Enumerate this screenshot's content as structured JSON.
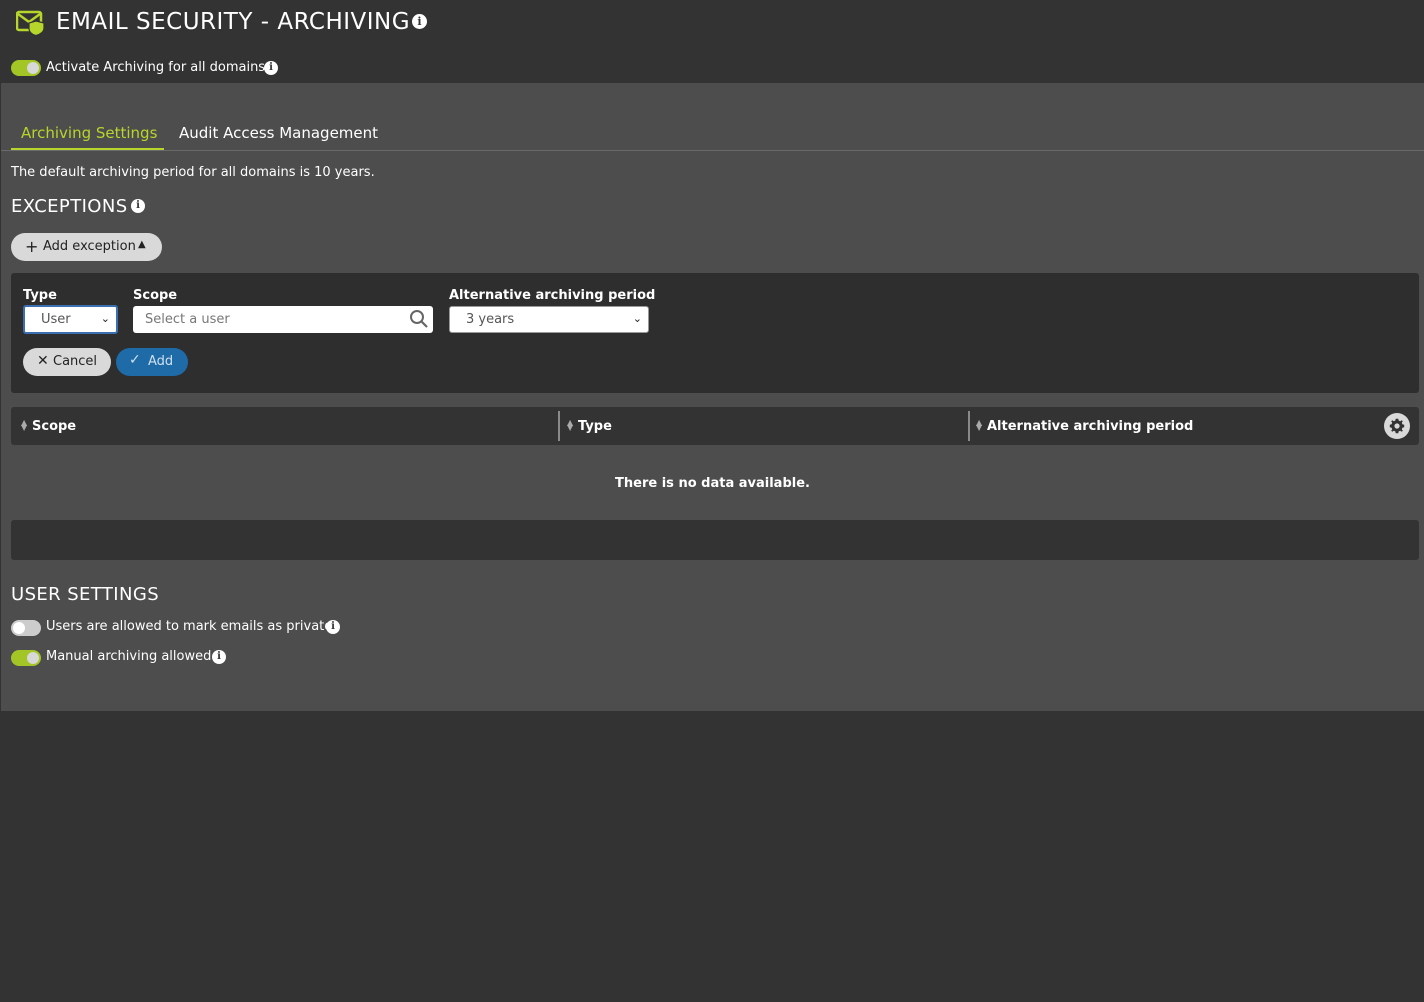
{
  "header": {
    "title": "EMAIL SECURITY - ARCHIVING",
    "logo_icon": "envelope-shield-icon",
    "activate_label": "Activate Archiving for all domains",
    "activate_on": true
  },
  "tabs": [
    {
      "label": "Archiving Settings",
      "active": true
    },
    {
      "label": "Audit Access Management",
      "active": false
    }
  ],
  "settings": {
    "default_period_text": "The default archiving period for all domains is 10 years."
  },
  "exceptions": {
    "title": "EXCEPTIONS",
    "add_button_label": "Add exception",
    "form": {
      "type_label": "Type",
      "type_value": "User",
      "scope_label": "Scope",
      "scope_placeholder": "Select a user",
      "period_label": "Alternative archiving period",
      "period_value": "3 years",
      "cancel_label": "Cancel",
      "add_label": "Add"
    },
    "table": {
      "columns": [
        "Scope",
        "Type",
        "Alternative archiving period"
      ],
      "empty_text": "There is no data available."
    }
  },
  "user_settings": {
    "title": "USER SETTINGS",
    "private_label": "Users are allowed to mark emails as private",
    "private_on": false,
    "manual_label": "Manual archiving allowed",
    "manual_on": true
  },
  "colors": {
    "accent": "#b6d62b",
    "toggle_on": "#a3c626",
    "primary_button": "#1e6ba8",
    "panel_bg": "#4d4d4d",
    "page_bg": "#333333"
  }
}
